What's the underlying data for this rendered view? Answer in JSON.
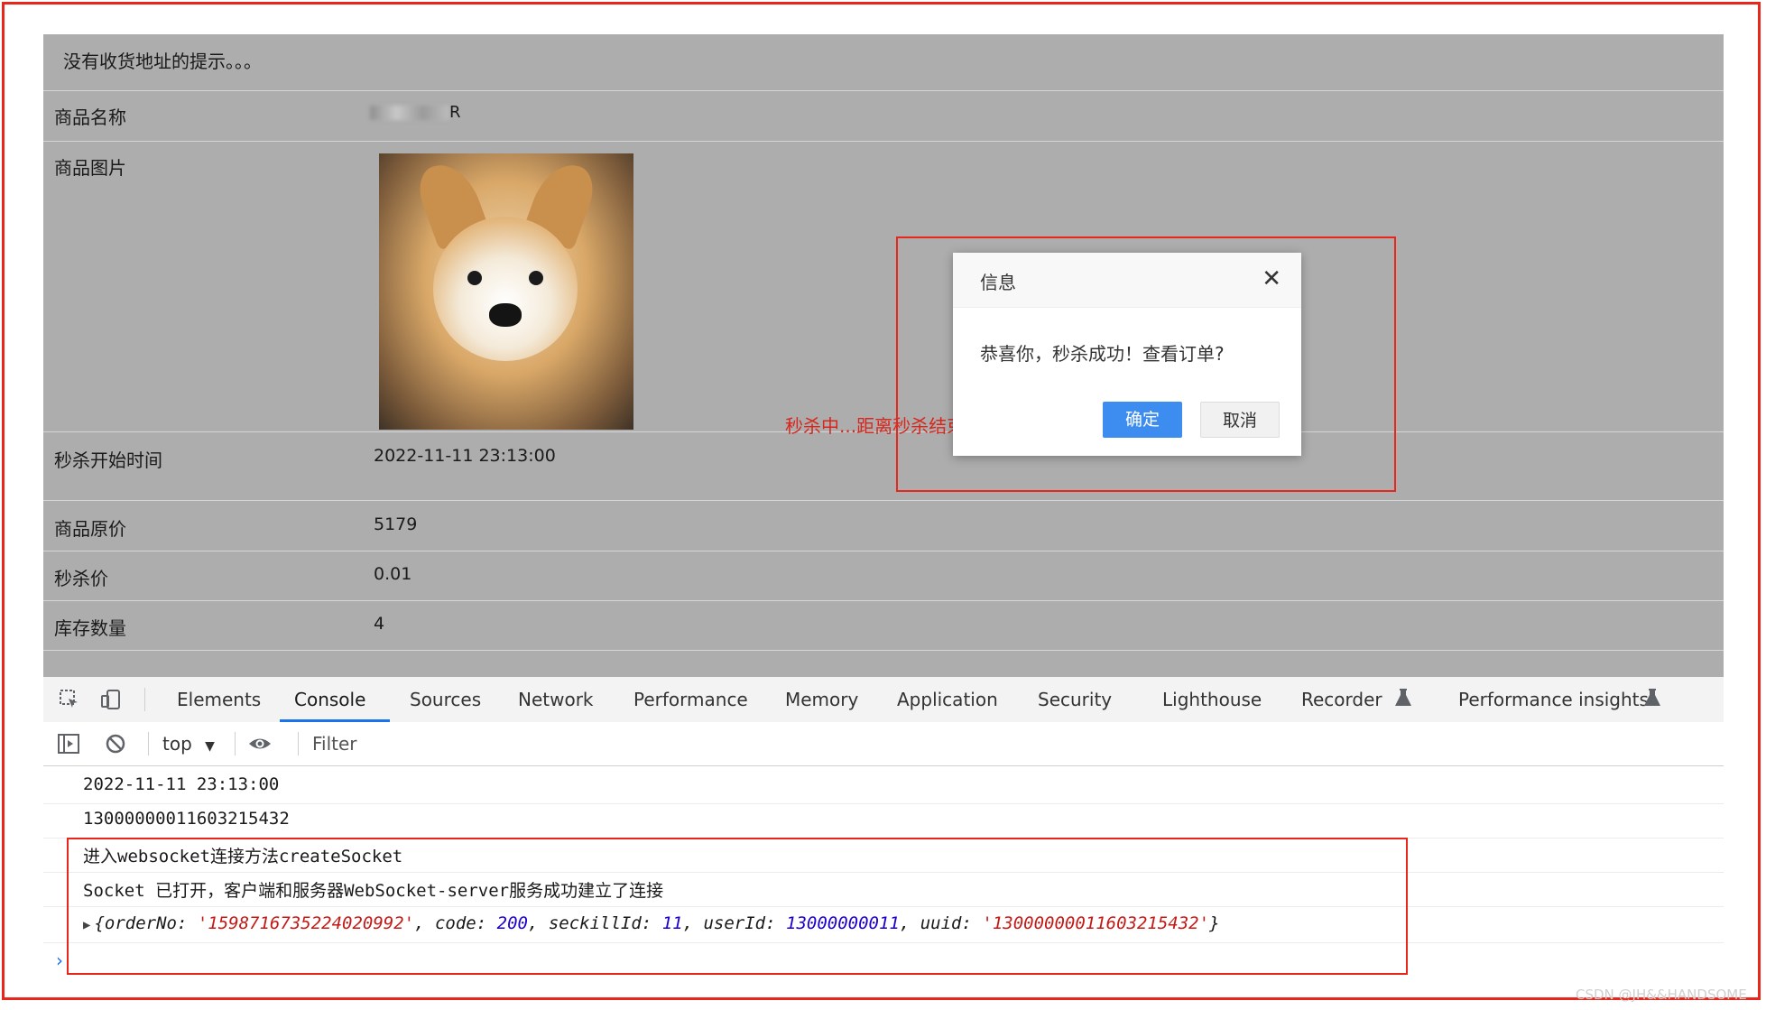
{
  "page": {
    "notice": "没有收货地址的提示。。。",
    "rows": {
      "name_label": "商品名称",
      "name_value_suffix": "R",
      "image_label": "商品图片",
      "start_label": "秒杀开始时间",
      "start_value": "2022-11-11 23:13:00",
      "countdown": "秒杀中...距离秒杀结束还有：27 天 22 时 40 分 11 秒",
      "original_price_label": "商品原价",
      "original_price_value": "5179",
      "seckill_price_label": "秒杀价",
      "seckill_price_value": "0.01",
      "stock_label": "库存数量",
      "stock_value": "4"
    }
  },
  "dialog": {
    "title": "信息",
    "close_glyph": "✕",
    "message": "恭喜你，秒杀成功！查看订单?",
    "ok_label": "确定",
    "cancel_label": "取消"
  },
  "devtools": {
    "tabs": [
      "Elements",
      "Console",
      "Sources",
      "Network",
      "Performance",
      "Memory",
      "Application",
      "Security",
      "Lighthouse",
      "Recorder",
      "Performance insights"
    ],
    "active_tab": "Console",
    "context": "top",
    "filter_placeholder": "Filter",
    "icons": {
      "inspect": "inspect-element-icon",
      "device": "device-toolbar-icon",
      "sidebar": "console-sidebar-icon",
      "clear": "clear-console-icon",
      "eye": "live-expression-icon",
      "flask": "experimental-flask-icon"
    },
    "console": {
      "line1": "2022-11-11 23:13:00",
      "line2": "13000000011603215432",
      "line3": "进入websocket连接方法createSocket",
      "line4": "Socket 已打开，客户端和服务器WebSocket-server服务成功建立了连接",
      "object": {
        "k1": "orderNo",
        "v1": "'1598716735224020992'",
        "k2": "code",
        "v2": "200",
        "k3": "seckillId",
        "v3": "11",
        "k4": "userId",
        "v4": "13000000011",
        "k5": "uuid",
        "v5": "'13000000011603215432'"
      }
    }
  },
  "watermark": "CSDN @JH&&HANDSOME",
  "colors": {
    "annotation_red": "#e8261c",
    "primary_button": "#3d8cf0",
    "countdown_red": "#d7261c",
    "page_overlay_gray": "#adadad"
  }
}
